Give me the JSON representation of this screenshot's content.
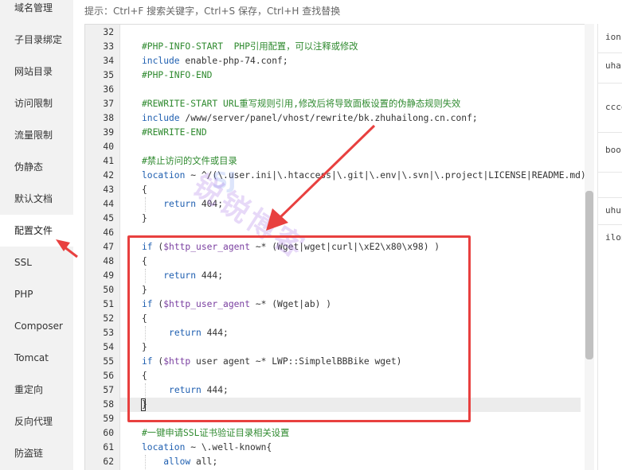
{
  "sidebar": {
    "items": [
      {
        "label": "域名管理"
      },
      {
        "label": "子目录绑定"
      },
      {
        "label": "网站目录"
      },
      {
        "label": "访问限制"
      },
      {
        "label": "流量限制"
      },
      {
        "label": "伪静态"
      },
      {
        "label": "默认文档"
      },
      {
        "label": "配置文件",
        "active": true
      },
      {
        "label": "SSL"
      },
      {
        "label": "PHP"
      },
      {
        "label": "Composer"
      },
      {
        "label": "Tomcat"
      },
      {
        "label": "重定向"
      },
      {
        "label": "反向代理"
      },
      {
        "label": "防盗链"
      }
    ]
  },
  "hint": "提示：Ctrl+F 搜索关键字，Ctrl+S 保存，Ctrl+H 查找替换",
  "editor": {
    "lines": [
      {
        "n": "32",
        "code": ""
      },
      {
        "n": "33",
        "code": "#PHP-INFO-START  PHP引用配置，可以注释或修改"
      },
      {
        "n": "34",
        "code": "include enable-php-74.conf;"
      },
      {
        "n": "35",
        "code": "#PHP-INFO-END"
      },
      {
        "n": "36",
        "code": ""
      },
      {
        "n": "37",
        "code": "#REWRITE-START URL重写规则引用,修改后将导致面板设置的伪静态规则失效"
      },
      {
        "n": "38",
        "code": "include /www/server/panel/vhost/rewrite/bk.zhuhailong.cn.conf;"
      },
      {
        "n": "39",
        "code": "#REWRITE-END"
      },
      {
        "n": "40",
        "code": ""
      },
      {
        "n": "41",
        "code": "#禁止访问的文件或目录"
      },
      {
        "n": "42",
        "code": "location ~ ^/(\\.user.ini|\\.htaccess|\\.git|\\.env|\\.svn|\\.project|LICENSE|README.md)"
      },
      {
        "n": "43",
        "code": "{"
      },
      {
        "n": "44",
        "code": "    return 404;"
      },
      {
        "n": "45",
        "code": "}"
      },
      {
        "n": "46",
        "code": ""
      },
      {
        "n": "47",
        "code": "if ($http_user_agent ~* (Wget|wget|curl|\\xE2\\x80\\x98) )"
      },
      {
        "n": "48",
        "code": "{"
      },
      {
        "n": "49",
        "code": "    return 444;"
      },
      {
        "n": "50",
        "code": "}"
      },
      {
        "n": "51",
        "code": "if ($http_user_agent ~* (Wget|ab) )"
      },
      {
        "n": "52",
        "code": "{"
      },
      {
        "n": "53",
        "code": "     return 444;"
      },
      {
        "n": "54",
        "code": "}"
      },
      {
        "n": "55",
        "code": "if ($http user agent ~* LWP::SimplelBBBike wget)"
      },
      {
        "n": "56",
        "code": "{"
      },
      {
        "n": "57",
        "code": "     return 444;"
      },
      {
        "n": "58",
        "code": "}"
      },
      {
        "n": "59",
        "code": ""
      },
      {
        "n": "60",
        "code": "#一键申请SSL证书验证目录相关设置"
      },
      {
        "n": "61",
        "code": "location ~ \\.well-known{"
      },
      {
        "n": "62",
        "code": "    allow all;"
      }
    ]
  },
  "right_strip": {
    "fragments": [
      "ion",
      "uha",
      "ccco",
      "boo",
      "uhu",
      "ilon"
    ]
  },
  "watermark": "锐锐博客",
  "colors": {
    "comment": "#2f8a2f",
    "keyword": "#1f5fb0",
    "highlight": "#e8403f"
  }
}
